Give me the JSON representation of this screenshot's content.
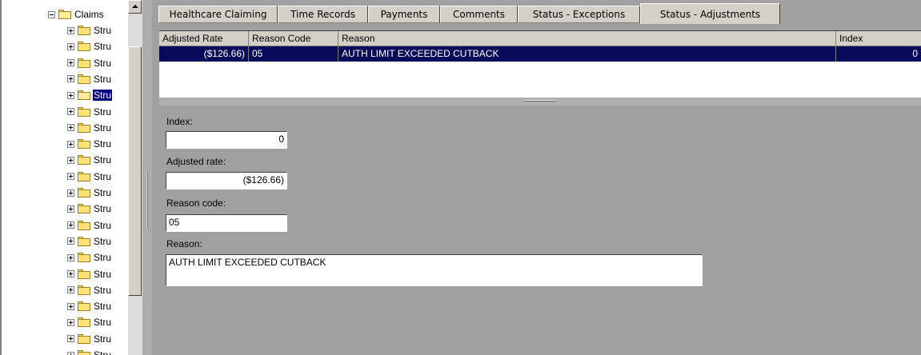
{
  "tree": {
    "root_label": "Claims",
    "child_label": "Stru",
    "child_count": 21,
    "selected_index": 4
  },
  "tabs": [
    {
      "label": "Healthcare Claiming",
      "active": false
    },
    {
      "label": "Time Records",
      "active": false
    },
    {
      "label": "Payments",
      "active": false
    },
    {
      "label": "Comments",
      "active": false
    },
    {
      "label": "Status - Exceptions",
      "active": false
    },
    {
      "label": "Status - Adjustments",
      "active": true
    }
  ],
  "grid": {
    "columns": [
      "Adjusted Rate",
      "Reason Code",
      "Reason",
      "Index"
    ],
    "rows": [
      {
        "adjusted_rate": "($126.66)",
        "reason_code": "05",
        "reason": "AUTH LIMIT EXCEEDED CUTBACK",
        "index": "0"
      }
    ]
  },
  "detail": {
    "index_label": "Index:",
    "index_value": "0",
    "adjusted_rate_label": "Adjusted rate:",
    "adjusted_rate_value": "($126.66)",
    "reason_code_label": "Reason code:",
    "reason_code_value": "05",
    "reason_label": "Reason:",
    "reason_value": "AUTH LIMIT EXCEEDED CUTBACK"
  },
  "colors": {
    "selection": "#0a0a5a",
    "tree_selection": "#000080",
    "folder": "#ffe17a",
    "panel_background": "#a0a0a0"
  }
}
